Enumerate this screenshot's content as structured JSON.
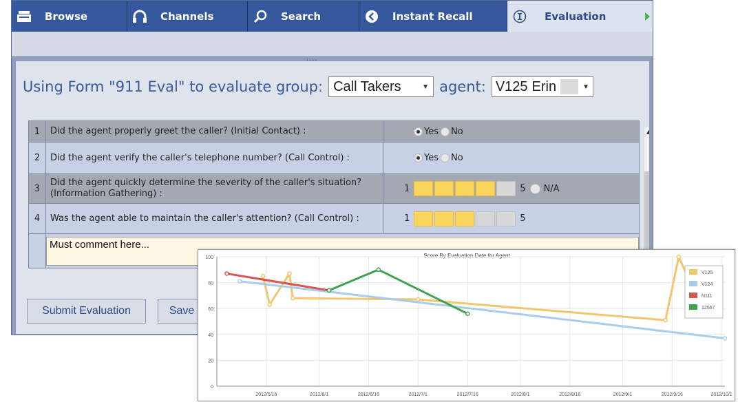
{
  "tabs": [
    {
      "label": "Browse",
      "icon": "browse-icon"
    },
    {
      "label": "Channels",
      "icon": "headphones-icon"
    },
    {
      "label": "Search",
      "icon": "search-icon"
    },
    {
      "label": "Instant Recall",
      "icon": "recall-icon"
    },
    {
      "label": "Evaluation",
      "icon": "info-icon",
      "active": true
    }
  ],
  "grip": "....",
  "heading": {
    "prefix": "Using Form \"911 Eval\" to evaluate group:",
    "group_value": "Call Takers",
    "agent_label": "agent:",
    "agent_value": "V125",
    "agent_name": "Erin"
  },
  "questions": [
    {
      "num": "1",
      "text": "Did the agent properly greet the caller? (Initial Contact) :",
      "answer_type": "yesno",
      "yes": "Yes",
      "no": "No",
      "selected": "yes"
    },
    {
      "num": "2",
      "text": "Did the agent verify the caller's telephone number? (Call Control) :",
      "answer_type": "yesno",
      "yes": "Yes",
      "no": "No",
      "selected": "yes"
    },
    {
      "num": "3",
      "text": "Did the agent quickly determine the severity of the caller's situation? (Information Gathering) :",
      "answer_type": "scale",
      "min": "1",
      "max": "5",
      "level": 4,
      "na": "N/A"
    },
    {
      "num": "4",
      "text": "Was the agent able to maintain the caller's attention? (Call Control) :",
      "answer_type": "scale",
      "min": "1",
      "max": "5",
      "level": 3
    }
  ],
  "comment": "Must comment here...",
  "buttons": {
    "submit": "Submit Evaluation",
    "save": "Save"
  },
  "colors": {
    "tab_bg": "#34589b",
    "active_tab_bg": "#dde3ee",
    "heading": "#3a5a9c",
    "scale_on": "#fbd55b"
  },
  "chart_data": {
    "type": "line",
    "title": "Score By Evaluation Date for Agent",
    "ylim": [
      0,
      100
    ],
    "yticks": [
      0,
      20,
      40,
      60,
      80,
      100
    ],
    "xticks": [
      "2012/5/16",
      "2012/6/1",
      "2012/6/16",
      "2012/7/1",
      "2012/7/16",
      "2012/8/1",
      "2012/8/16",
      "2012/9/1",
      "2012/9/16",
      "2012/10/1"
    ],
    "xrange": [
      "2012/5/1",
      "2012/10/2"
    ],
    "grid": true,
    "legend_position": "top-right",
    "series": [
      {
        "name": "V125",
        "color": "#f2c66a",
        "points": [
          [
            "2012/5/15",
            85
          ],
          [
            "2012/5/17",
            63
          ],
          [
            "2012/5/23",
            87
          ],
          [
            "2012/5/24",
            68
          ],
          [
            "2012/7/1",
            67
          ],
          [
            "2012/9/14",
            51
          ],
          [
            "2012/9/18",
            100
          ],
          [
            "2012/9/22",
            77
          ]
        ]
      },
      {
        "name": "V124",
        "color": "#a9cce8",
        "points": [
          [
            "2012/5/8",
            81
          ],
          [
            "2012/10/2",
            37
          ]
        ]
      },
      {
        "name": "N111",
        "color": "#d9534f",
        "points": [
          [
            "2012/5/4",
            87
          ],
          [
            "2012/6/4",
            74
          ]
        ]
      },
      {
        "name": "12567",
        "color": "#3fa34d",
        "points": [
          [
            "2012/6/4",
            74
          ],
          [
            "2012/6/19",
            90
          ],
          [
            "2012/7/16",
            56
          ]
        ]
      }
    ]
  }
}
